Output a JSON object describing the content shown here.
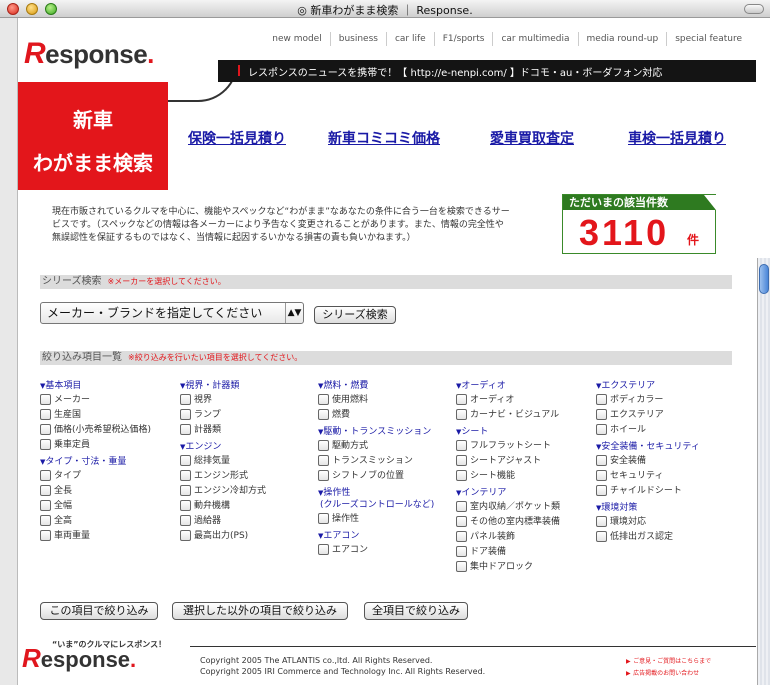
{
  "window": {
    "title": "◎ 新車わがまま検索 ｜ Response."
  },
  "header": {
    "logo_r": "R",
    "logo_rest": "esponse",
    "logo_dot": ".",
    "nav": [
      "new model",
      "business",
      "car life",
      "F1/sports",
      "car multimedia",
      "media round-up",
      "special feature"
    ],
    "banner": "レスポンスのニュースを携帯で！【 http://e-nenpi.com/ 】ドコモ・au・ボーダフォン対応"
  },
  "hero": {
    "line1": "新車",
    "line2": "わがまま検索",
    "links": [
      "保険一括見積り",
      "新車コミコミ価格",
      "愛車買取査定",
      "車検一括見積り"
    ]
  },
  "description": "現在市販されているクルマを中心に、機能やスペックなど“わがまま”なあなたの条件に合う一台を検索できるサービスです。（スペックなどの情報は各メーカーにより予告なく変更されることがあります。また、情報の完全性や無誤認性を保証するものではなく、当情報に起因するいかなる損害の責も負いかねます。）",
  "count": {
    "label": "ただいまの該当件数",
    "value": "3110",
    "unit": "件"
  },
  "series_search": {
    "title": "シリーズ検索",
    "note": "※メーカーを選択してください。",
    "select_value": "メーカー・ブランドを指定してください",
    "button": "シリーズ検索"
  },
  "filter": {
    "title": "絞り込み項目一覧",
    "note": "※絞り込みを行いたい項目を選択してください。",
    "columns": [
      [
        {
          "title": "基本項目",
          "items": [
            "メーカー",
            "生産国",
            "価格(小売希望税込価格)",
            "乗車定員"
          ]
        },
        {
          "title": "タイプ・寸法・重量",
          "items": [
            "タイプ",
            "全長",
            "全幅",
            "全高",
            "車両重量"
          ]
        }
      ],
      [
        {
          "title": "視界・計器類",
          "items": [
            "視界",
            "ランプ",
            "計器類"
          ]
        },
        {
          "title": "エンジン",
          "items": [
            "総排気量",
            "エンジン形式",
            "エンジン冷却方式",
            "動弁機構",
            "過給器",
            "最高出力(PS)"
          ]
        }
      ],
      [
        {
          "title": "燃料・燃費",
          "items": [
            "使用燃料",
            "燃費"
          ]
        },
        {
          "title": "駆動・トランスミッション",
          "items": [
            "駆動方式",
            "トランスミッション",
            "シフトノブの位置"
          ]
        },
        {
          "title": "操作性",
          "subtitle": "(クルーズコントロールなど)",
          "items": [
            "操作性"
          ]
        },
        {
          "title": "エアコン",
          "items": [
            "エアコン"
          ]
        }
      ],
      [
        {
          "title": "オーディオ",
          "items": [
            "オーディオ",
            "カーナビ・ビジュアル"
          ]
        },
        {
          "title": "シート",
          "items": [
            "フルフラットシート",
            "シートアジャスト",
            "シート機能"
          ]
        },
        {
          "title": "インテリア",
          "items": [
            "室内収納／ポケット類",
            "その他の室内標準装備",
            "パネル装飾",
            "ドア装備",
            "集中ドアロック"
          ]
        }
      ],
      [
        {
          "title": "エクステリア",
          "items": [
            "ボディカラー",
            "エクステリア",
            "ホイール"
          ]
        },
        {
          "title": "安全装備・セキュリティ",
          "items": [
            "安全装備",
            "セキュリティ",
            "チャイルドシート"
          ]
        },
        {
          "title": "環境対策",
          "items": [
            "環境対応",
            "低排出ガス認定"
          ]
        }
      ]
    ],
    "buttons": [
      "この項目で絞り込み",
      "選択した以外の項目で絞り込み",
      "全項目で絞り込み"
    ]
  },
  "footer": {
    "slogan": "“いま”のクルマにレスポンス！",
    "logo_r": "R",
    "logo_rest": "esponse",
    "logo_dot": ".",
    "copy1": "Copyright 2005 The ATLANTIS co.,ltd. All Rights Reserved.",
    "copy2": "Copyright 2005 IRI Commerce and Technology Inc. All Rights Reserved.",
    "link1": "ご意見・ご質問はこちらまで",
    "link2": "広告掲載のお問い合わせ"
  },
  "colors": {
    "brand_red": "#e3161b",
    "link_blue": "#1a1aa6",
    "count_green": "#2e7a20"
  }
}
